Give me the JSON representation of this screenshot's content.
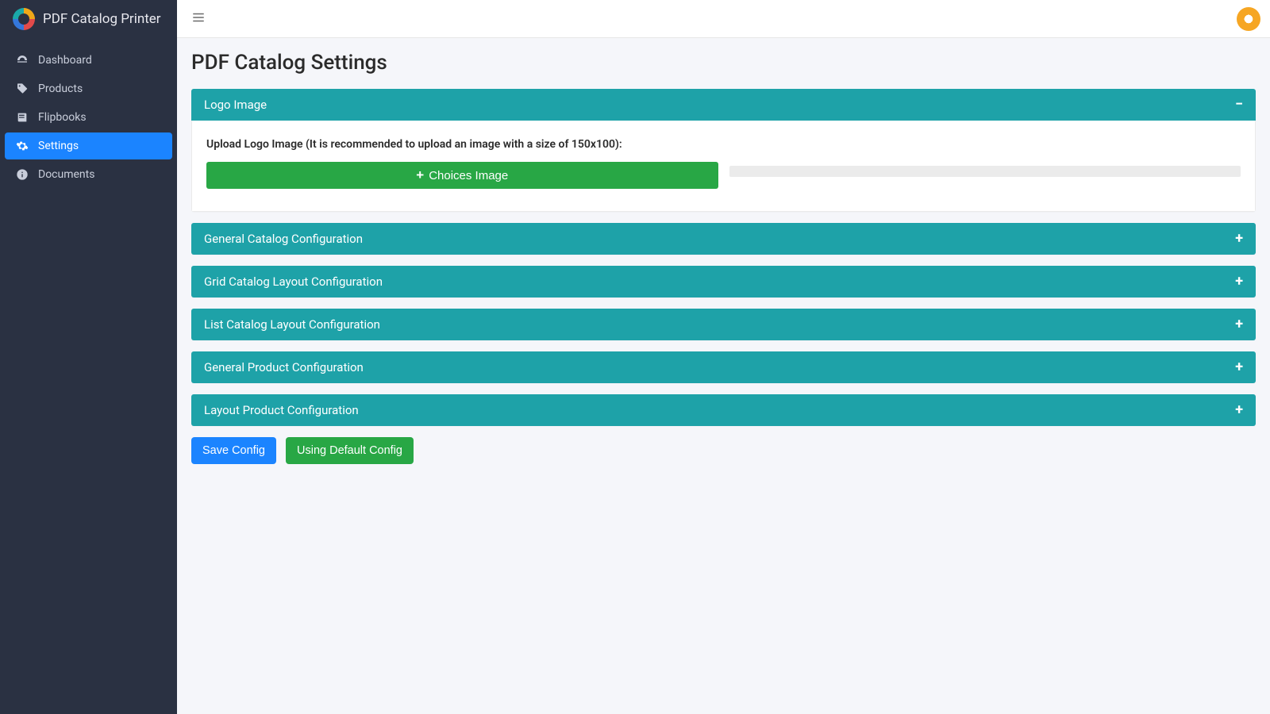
{
  "brand": {
    "title": "PDF Catalog Printer"
  },
  "sidebar": {
    "items": [
      {
        "label": "Dashboard",
        "icon": "dashboard-icon",
        "active": false
      },
      {
        "label": "Products",
        "icon": "tag-icon",
        "active": false
      },
      {
        "label": "Flipbooks",
        "icon": "book-icon",
        "active": false
      },
      {
        "label": "Settings",
        "icon": "gear-icon",
        "active": true
      },
      {
        "label": "Documents",
        "icon": "info-icon",
        "active": false
      }
    ]
  },
  "page": {
    "title": "PDF Catalog Settings"
  },
  "panels": {
    "logo": {
      "title": "Logo Image",
      "expanded": true,
      "upload_label": "Upload Logo Image (It is recommended to upload an image with a size of 150x100):",
      "choices_btn": "Choices Image"
    },
    "general_catalog": {
      "title": "General Catalog Configuration"
    },
    "grid_layout": {
      "title": "Grid Catalog Layout Configuration"
    },
    "list_layout": {
      "title": "List Catalog Layout Configuration"
    },
    "general_product": {
      "title": "General Product Configuration"
    },
    "layout_product": {
      "title": "Layout Product Configuration"
    }
  },
  "actions": {
    "save": "Save Config",
    "default": "Using Default Config"
  }
}
